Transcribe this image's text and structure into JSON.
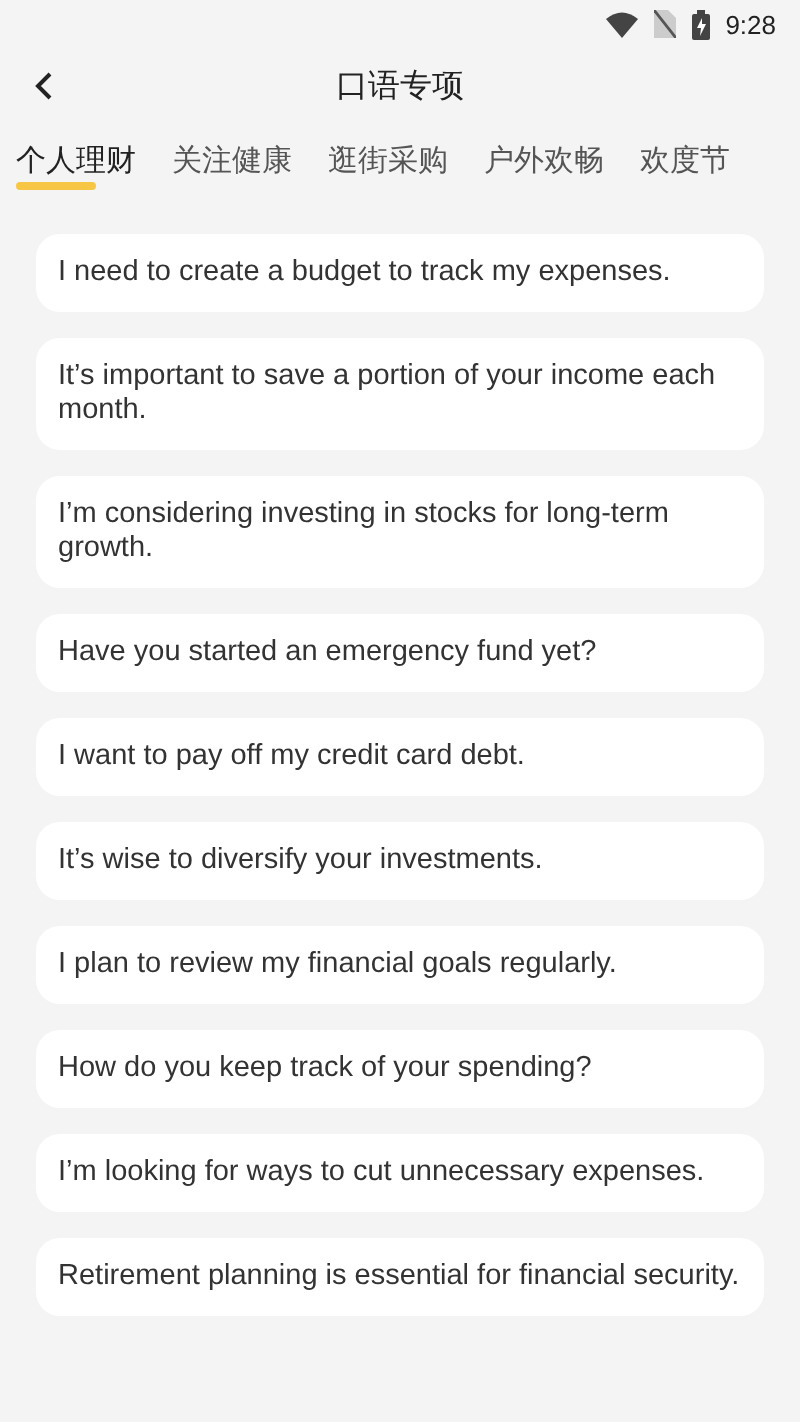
{
  "status_bar": {
    "time": "9:28"
  },
  "header": {
    "title": "口语专项"
  },
  "tabs": [
    {
      "label": "个人理财",
      "selected": true
    },
    {
      "label": "关注健康",
      "selected": false
    },
    {
      "label": "逛街采购",
      "selected": false
    },
    {
      "label": "户外欢畅",
      "selected": false
    },
    {
      "label": "欢度节",
      "selected": false
    }
  ],
  "sentences": [
    "I need to create a budget to track my expenses.",
    "It’s important to save a portion of your income each month.",
    "I’m considering investing in stocks for long-term growth.",
    "Have you started an emergency fund yet?",
    "I want to pay off my credit card debt.",
    "It’s wise to diversify your investments.",
    "I plan to review my financial goals regularly.",
    "How do you keep track of your spending?",
    "I’m looking for ways to cut unnecessary expenses.",
    "Retirement planning is essential for financial security."
  ]
}
